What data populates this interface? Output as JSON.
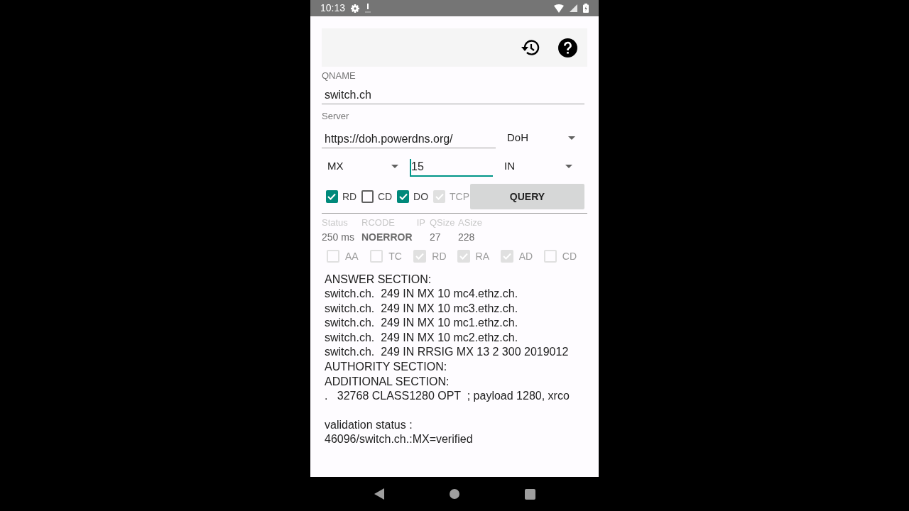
{
  "status_bar": {
    "time": "10:13"
  },
  "qname": {
    "label": "QNAME",
    "value": "switch.ch"
  },
  "server": {
    "label": "Server",
    "value": "https://doh.powerdns.org/",
    "protocol": "DoH"
  },
  "query": {
    "type": "MX",
    "edns_value": "15",
    "focused": true,
    "class": "IN"
  },
  "flags": [
    {
      "label": "RD",
      "checked": true,
      "disabled": false
    },
    {
      "label": "CD",
      "checked": false,
      "disabled": false
    },
    {
      "label": "DO",
      "checked": true,
      "disabled": false
    },
    {
      "label": "TCP",
      "checked": true,
      "disabled": true
    }
  ],
  "query_button": "QUERY",
  "result_columns": [
    {
      "header": "Status",
      "value": "250 ms",
      "bold": false
    },
    {
      "header": "RCODE",
      "value": "NOERROR",
      "bold": true
    },
    {
      "header": "IP"
    },
    {
      "header": "QSize",
      "value": "27",
      "bold": false
    },
    {
      "header": "ASize",
      "value": "228",
      "bold": false
    }
  ],
  "response_flags": [
    {
      "label": "AA",
      "checked": false
    },
    {
      "label": "TC",
      "checked": false
    },
    {
      "label": "RD",
      "checked": true
    },
    {
      "label": "RA",
      "checked": true
    },
    {
      "label": "AD",
      "checked": true
    },
    {
      "label": "CD",
      "checked": false
    }
  ],
  "output_lines": [
    "ANSWER SECTION:",
    "switch.ch.  249 IN MX 10 mc4.ethz.ch.",
    "switch.ch.  249 IN MX 10 mc3.ethz.ch.",
    "switch.ch.  249 IN MX 10 mc1.ethz.ch.",
    "switch.ch.  249 IN MX 10 mc2.ethz.ch.",
    "switch.ch.  249 IN RRSIG MX 13 2 300 2019012",
    "AUTHORITY SECTION:",
    "ADDITIONAL SECTION:",
    ".   32768 CLASS1280 OPT  ; payload 1280, xrco"
  ],
  "validation_lines": [
    "validation status :",
    "46096/switch.ch.:MX=verified"
  ]
}
